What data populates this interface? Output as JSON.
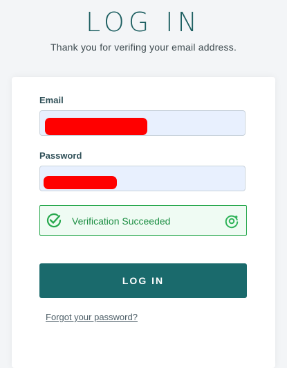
{
  "header": {
    "title": "LOG IN",
    "subtitle": "Thank you for verifing your email address."
  },
  "form": {
    "email_label": "Email",
    "password_label": "Password",
    "email_value_redacted": true,
    "password_value_redacted": true
  },
  "verification": {
    "status_text": "Verification Succeeded",
    "check_icon": "check-circle-icon",
    "provider_icon": "captcha-logo-icon",
    "colors": {
      "border": "#27a84d",
      "background": "#effbf3",
      "text": "#1e8f44"
    }
  },
  "actions": {
    "login_label": "LOG IN",
    "forgot_password_label": "Forgot your password?"
  },
  "colors": {
    "primary": "#1a6a6c",
    "title": "#1d5f61",
    "redaction": "#ff0000",
    "input_background": "#e8f0fe"
  }
}
